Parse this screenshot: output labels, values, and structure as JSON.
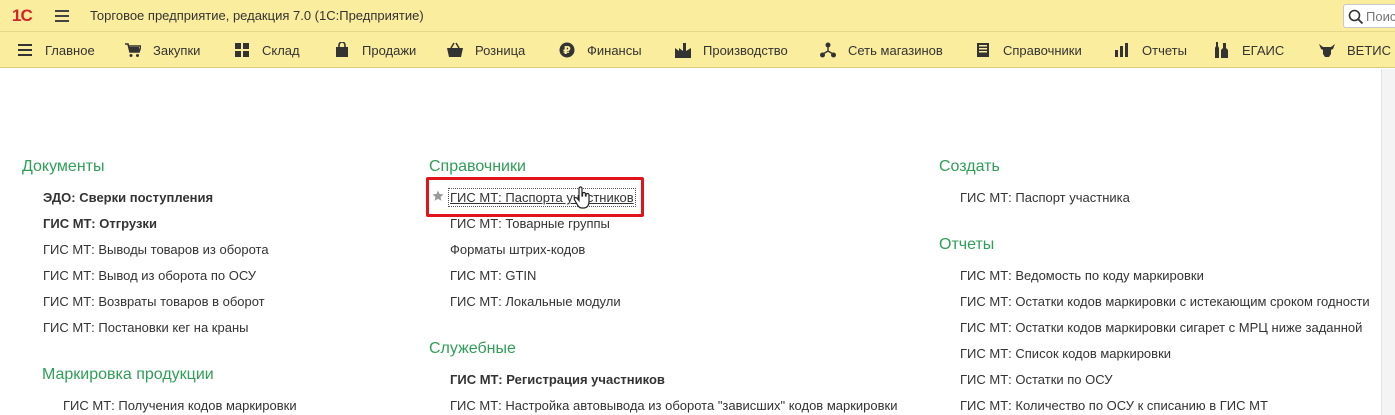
{
  "app": {
    "logo": "1С",
    "title": "Торговое предприятие, редакция 7.0  (1С:Предприятие)",
    "search_placeholder": "Поис"
  },
  "sections": [
    {
      "label": "Главное",
      "icon": "menu-icon"
    },
    {
      "label": "Закупки",
      "icon": "cart-icon"
    },
    {
      "label": "Склад",
      "icon": "warehouse-grid-icon"
    },
    {
      "label": "Продажи",
      "icon": "shopping-bag-icon"
    },
    {
      "label": "Розница",
      "icon": "basket-icon"
    },
    {
      "label": "Финансы",
      "icon": "ruble-coin-icon"
    },
    {
      "label": "Производство",
      "icon": "factory-icon"
    },
    {
      "label": "Сеть магазинов",
      "icon": "network-icon"
    },
    {
      "label": "Справочники",
      "icon": "book-icon"
    },
    {
      "label": "Отчеты",
      "icon": "bar-chart-icon"
    },
    {
      "label": "ЕГАИС",
      "icon": "bottles-icon"
    },
    {
      "label": "ВЕТИС",
      "icon": "cow-icon"
    }
  ],
  "columns": {
    "left": {
      "documents": {
        "title": "Документы",
        "items": [
          {
            "label": "ЭДО: Сверки поступления",
            "bold": true
          },
          {
            "label": "ГИС МТ: Отгрузки",
            "bold": true
          },
          {
            "label": "ГИС МТ: Выводы товаров из оборота",
            "bold": false
          },
          {
            "label": "ГИС МТ: Вывод из оборота по ОСУ",
            "bold": false
          },
          {
            "label": "ГИС МТ: Возвраты товаров в оборот",
            "bold": false
          },
          {
            "label": "ГИС МТ: Постановки кег на краны",
            "bold": false
          }
        ]
      },
      "marking": {
        "title": "Маркировка продукции",
        "items": [
          {
            "label": "ГИС МТ: Получения кодов маркировки",
            "bold": false
          }
        ]
      }
    },
    "middle": {
      "catalogs": {
        "title": "Справочники",
        "items": [
          {
            "label": "ГИС МТ: Паспорта участников",
            "bold": false,
            "starred": true,
            "hovered": true
          },
          {
            "label": "ГИС МТ: Товарные группы",
            "bold": false
          },
          {
            "label": "Форматы штрих-кодов",
            "bold": false
          },
          {
            "label": "ГИС МТ: GTIN",
            "bold": false
          },
          {
            "label": "ГИС МТ: Локальные модули",
            "bold": false
          }
        ]
      },
      "service": {
        "title": "Служебные",
        "items": [
          {
            "label": "ГИС МТ: Регистрация участников",
            "bold": true
          },
          {
            "label": "ГИС МТ: Настройка автовывода из оборота \"зависших\" кодов маркировки",
            "bold": false
          }
        ]
      }
    },
    "right": {
      "create": {
        "title": "Создать",
        "items": [
          {
            "label": "ГИС МТ: Паспорт участника",
            "bold": false
          }
        ]
      },
      "reports": {
        "title": "Отчеты",
        "items": [
          {
            "label": "ГИС МТ: Ведомость по коду маркировки",
            "bold": false
          },
          {
            "label": "ГИС МТ: Остатки кодов маркировки с истекающим сроком годности",
            "bold": false
          },
          {
            "label": "ГИС МТ: Остатки кодов маркировки сигарет с МРЦ ниже заданной",
            "bold": false
          },
          {
            "label": "ГИС МТ: Список кодов маркировки",
            "bold": false
          },
          {
            "label": "ГИС МТ: Остатки по ОСУ",
            "bold": false
          },
          {
            "label": "ГИС МТ: Количество по ОСУ к списанию в ГИС МТ",
            "bold": false
          }
        ]
      }
    }
  },
  "colors": {
    "panel_bg": "#fbed9e",
    "group_title": "#2f9e57",
    "highlight": "#e0141a",
    "logo": "#d6232a"
  }
}
